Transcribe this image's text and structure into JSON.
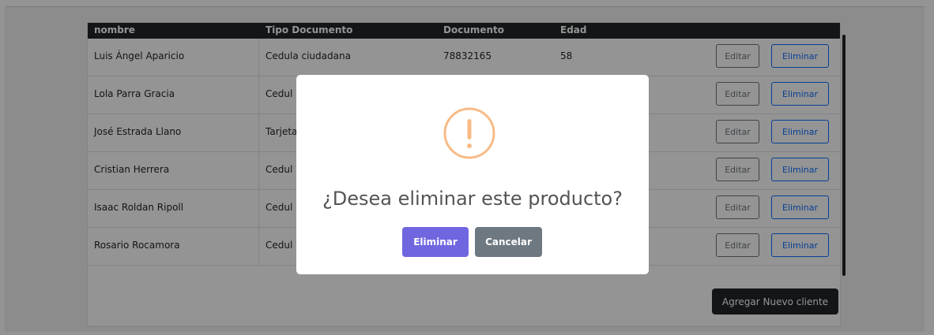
{
  "table": {
    "headers": [
      "nombre",
      "Tipo Documento",
      "Documento",
      "Edad"
    ],
    "rows": [
      {
        "nombre": "Luis Ángel Aparicio",
        "tipo": "Cedula ciudadana",
        "documento": "78832165",
        "edad": "58"
      },
      {
        "nombre": "Lola Parra Gracia",
        "tipo": "Cedul"
      },
      {
        "nombre": "José Estrada Llano",
        "tipo": "Tarjeta"
      },
      {
        "nombre": "Cristian Herrera",
        "tipo": "Cedul"
      },
      {
        "nombre": "Isaac Roldan Ripoll",
        "tipo": "Cedul"
      },
      {
        "nombre": "Rosario Rocamora",
        "tipo": "Cedul"
      }
    ],
    "edit_label": "Editar",
    "delete_label": "Eliminar"
  },
  "add_button_label": "Agregar Nuevo cliente",
  "modal": {
    "icon": "warning-icon",
    "title": "¿Desea eliminar este producto?",
    "confirm_label": "Eliminar",
    "cancel_label": "Cancelar"
  },
  "colors": {
    "header_bg": "#212529",
    "confirm": "#7066e0",
    "cancel": "#6e7881",
    "warning": "#f8bb86"
  }
}
